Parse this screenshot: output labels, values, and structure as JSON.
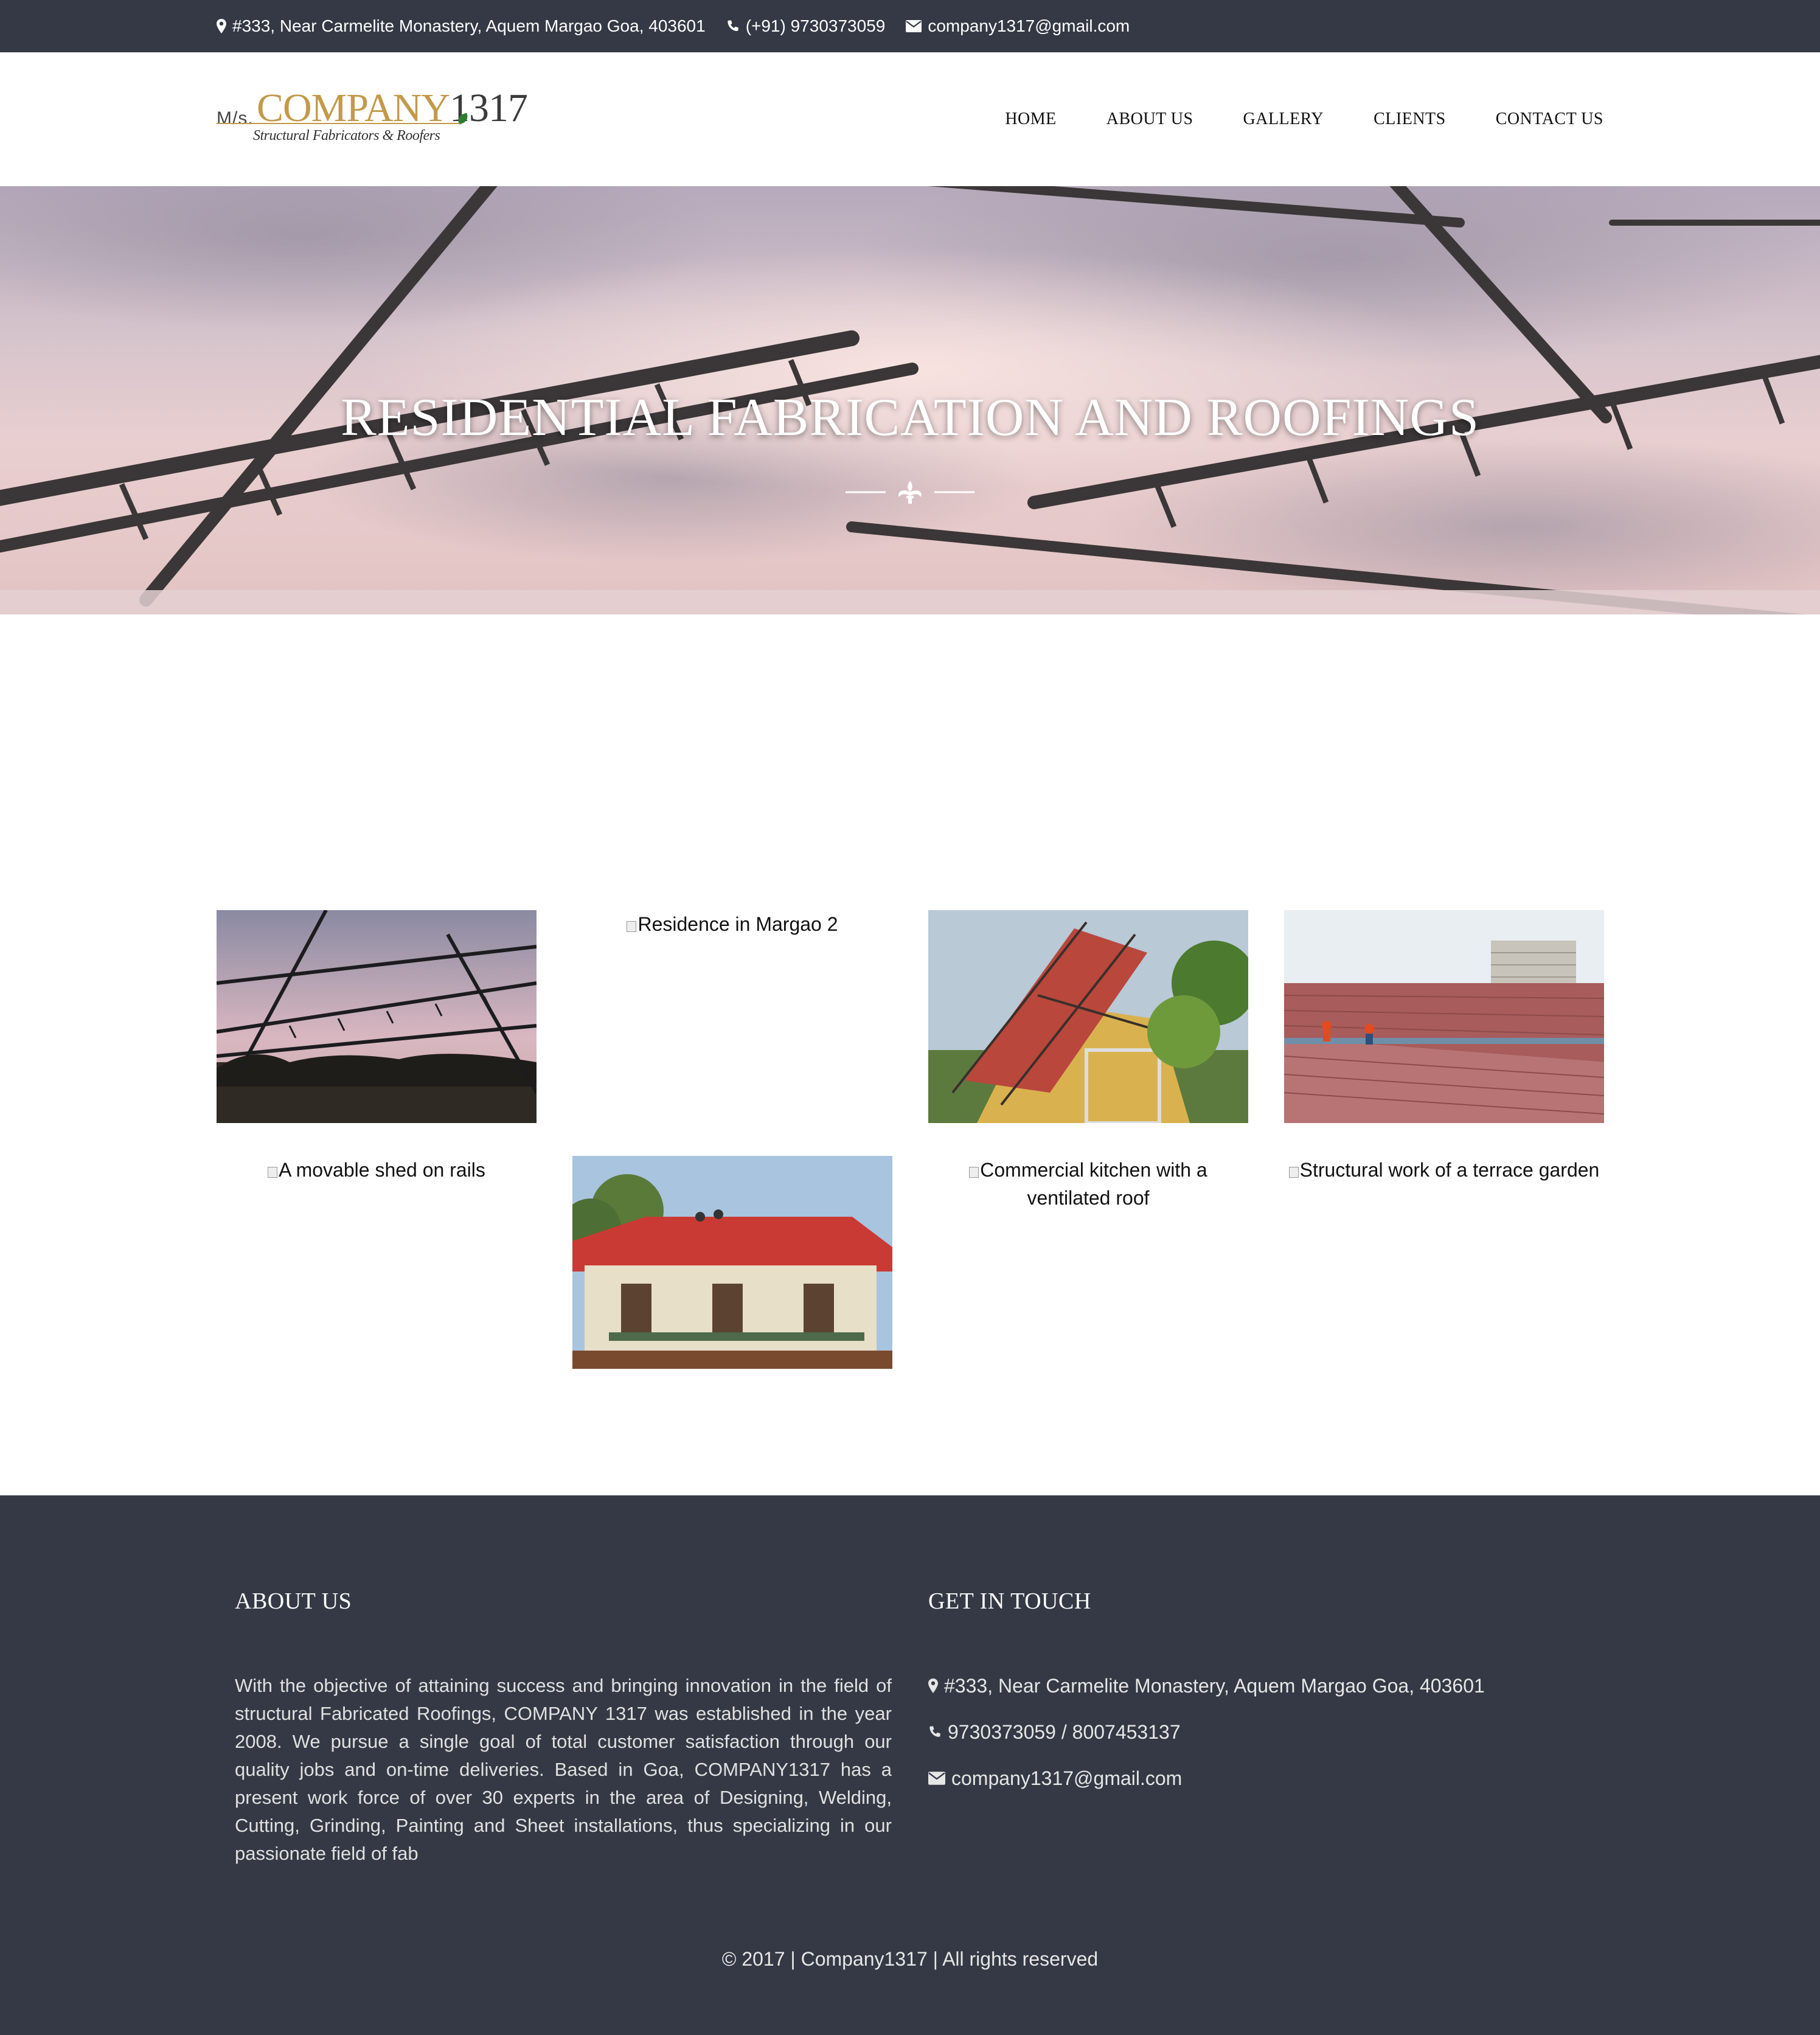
{
  "topbar": {
    "address": "#333, Near Carmelite Monastery, Aquem Margao Goa, 403601",
    "phone": "(+91) 9730373059",
    "email": "company1317@gmail.com",
    "icons": [
      "map-marker-icon",
      "phone-icon",
      "envelope-icon"
    ]
  },
  "logo": {
    "prefix": "M/s.",
    "brand": "COMPANY",
    "brand_num": "1317",
    "tagline": "Structural Fabricators & Roofers"
  },
  "nav": {
    "items": [
      "HOME",
      "ABOUT US",
      "GALLERY",
      "CLIENTS",
      "CONTACT US"
    ]
  },
  "hero": {
    "title": "RESIDENTIAL FABRICATION AND ROOFINGS"
  },
  "gallery": {
    "items": [
      {
        "alt": "",
        "loaded": true,
        "picture": "steel roof frame at dusk"
      },
      {
        "alt": "Residence in Margao 2",
        "loaded": false
      },
      {
        "alt": "",
        "loaded": true,
        "picture": "roof structure on yellow house"
      },
      {
        "alt": "",
        "loaded": true,
        "picture": "red tiled roof with workers"
      },
      {
        "alt": "A movable shed on rails",
        "loaded": false
      },
      {
        "alt": "",
        "loaded": true,
        "picture": "red roof on heritage house"
      },
      {
        "alt": "Commercial kitchen with a ventilated roof",
        "loaded": false
      },
      {
        "alt": "Structural work of a terrace garden",
        "loaded": false
      }
    ]
  },
  "footer": {
    "about_heading": "ABOUT US",
    "about_text": "With the objective of attaining success and bringing innovation in the field of structural Fabricated Roofings, COMPANY 1317 was established in the year 2008. We pursue a single goal of total customer satisfaction through our quality jobs and on-time deliveries. Based in Goa, COMPANY1317 has a present work force of over 30 experts in the area of Designing, Welding, Cutting, Grinding, Painting and Sheet installations, thus specializing in our passionate field of fab",
    "contact_heading": "GET IN TOUCH",
    "contact_address": "#333, Near Carmelite Monastery, Aquem Margao Goa, 403601",
    "contact_phone": "9730373059 / 8007453137",
    "contact_email": "company1317@gmail.com",
    "copyright": "© 2017 | Company1317 | All rights reserved"
  },
  "colors": {
    "topbar_bg": "#343945",
    "footer_bg": "#343945",
    "logo_gold": "#c39a4a"
  }
}
